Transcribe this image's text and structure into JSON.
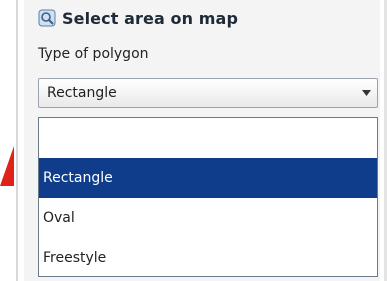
{
  "panel": {
    "title": "Select area on map",
    "icon": "map-select-icon"
  },
  "field": {
    "label": "Type of polygon"
  },
  "select": {
    "value": "Rectangle",
    "arrow_icon": "chevron-down-icon"
  },
  "dropdown": {
    "options": [
      {
        "label": "",
        "selected": false
      },
      {
        "label": "Rectangle",
        "selected": true
      },
      {
        "label": "Oval",
        "selected": false
      },
      {
        "label": "Freestyle",
        "selected": false
      }
    ]
  },
  "colors": {
    "selection": "#0f3d8c",
    "arrow": "#e0231a",
    "panel_background": "#f4f4f4"
  }
}
